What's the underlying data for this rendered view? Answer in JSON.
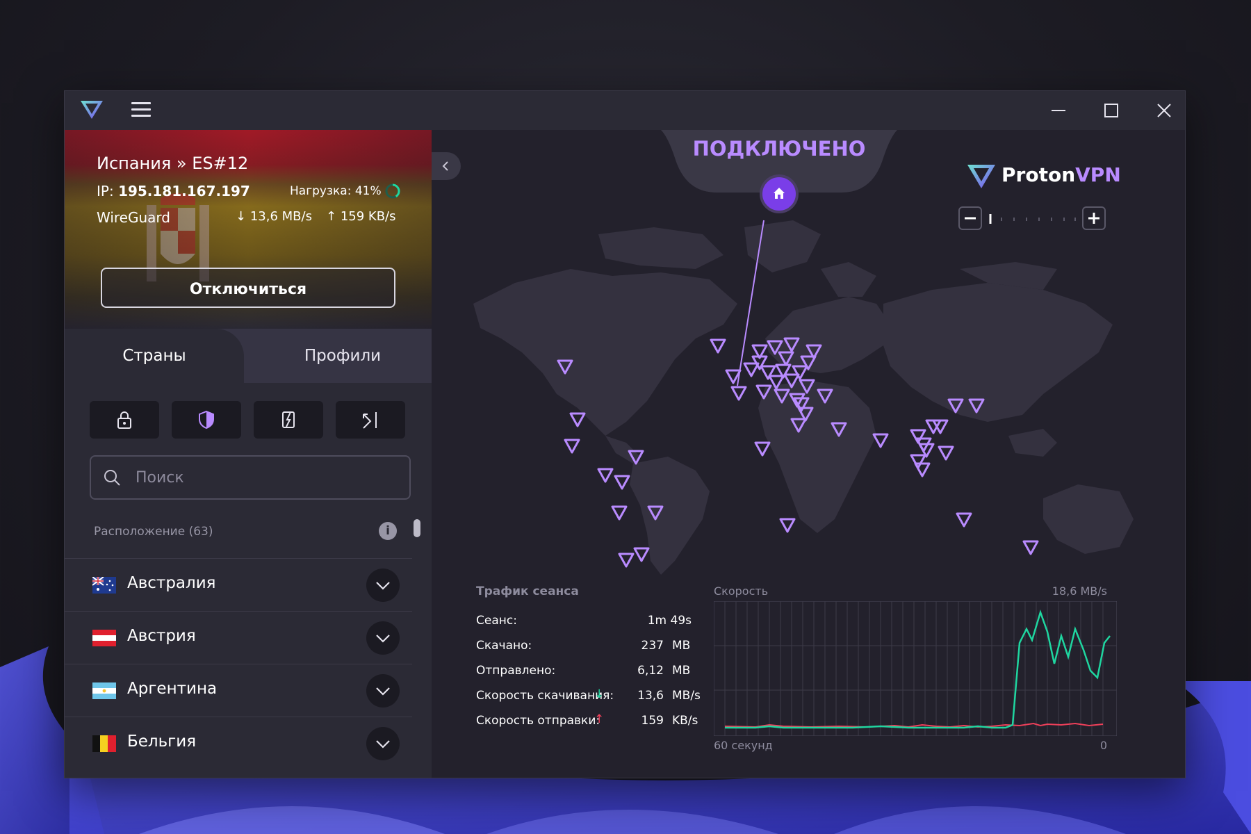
{
  "window": {
    "menu_icon": "hamburger-icon",
    "controls": [
      "minimize-icon",
      "maximize-icon",
      "close-icon"
    ]
  },
  "connection": {
    "server": "Испания » ES#12",
    "ip_label": "IP:",
    "ip": "195.181.167.197",
    "load": "Нагрузка: 41%",
    "load_fraction": 0.41,
    "protocol": "WireGuard",
    "download": "13,6 MB/s",
    "upload": "159 KB/s",
    "disconnect_label": "Отключиться",
    "header_colors": [
      "#a81a27",
      "#8b6f1c"
    ]
  },
  "tabs": [
    {
      "label": "Страны",
      "active": true
    },
    {
      "label": "Профили",
      "active": false
    }
  ],
  "filters": [
    "lock-icon",
    "shield-icon",
    "p2p-icon",
    "tor-icon"
  ],
  "search": {
    "placeholder": "Поиск",
    "value": ""
  },
  "locations": {
    "label": "Расположение (63)",
    "countries": [
      {
        "name": "Австралия",
        "flag": "australia"
      },
      {
        "name": "Австрия",
        "flag": "austria"
      },
      {
        "name": "Аргентина",
        "flag": "argentina"
      },
      {
        "name": "Бельгия",
        "flag": "belgium"
      }
    ]
  },
  "map": {
    "status": "ПОДКЛЮЧЕНО",
    "brand_proton": "Proton",
    "brand_vpn": "VPN",
    "accent": "#b98bff",
    "zoom_level_fraction": 0.0
  },
  "session": {
    "title": "Трафик сеанса",
    "rows": [
      {
        "label": "Сеанс:",
        "value": "1m 49s",
        "unit": ""
      },
      {
        "label": "Скачано:",
        "value": "237",
        "unit": "MB"
      },
      {
        "label": "Отправлено:",
        "value": "6,12",
        "unit": "MB"
      },
      {
        "label": "Скорость скачивания:",
        "value": "13,6",
        "unit": "MB/s",
        "arrow": "down"
      },
      {
        "label": "Скорость отправки:",
        "value": "159",
        "unit": "KB/s",
        "arrow": "up"
      }
    ]
  },
  "speed_chart": {
    "label": "Скорость",
    "max_label": "18,6 MB/s",
    "time_label": "60 секунд",
    "zero_label": "0",
    "download_color": "#1fd6a0",
    "upload_color": "#f0405a"
  }
}
